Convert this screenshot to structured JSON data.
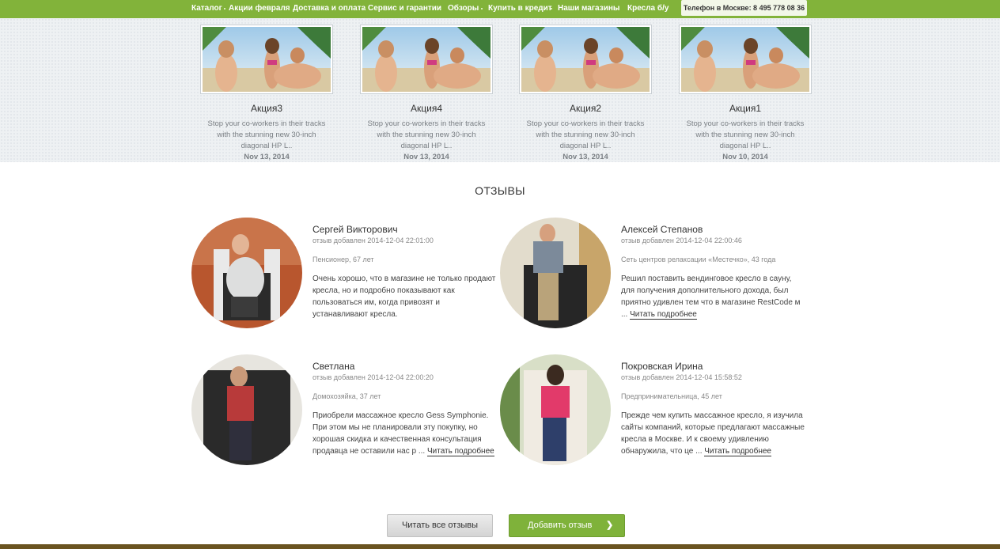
{
  "nav": {
    "items": [
      "Каталог",
      "Акции февраля",
      "Доставка и оплата",
      "Сервис и гарантии",
      "Обзоры",
      "Купить в кредит",
      "Наши магазины",
      "Кресла б/у"
    ],
    "phone": "Телефон в Москве: 8 495 778 08 36"
  },
  "promos": [
    {
      "title": "Акция3",
      "desc": "Stop your co-workers in their tracks with the stunning new 30-inch diagonal HP L..",
      "date": "Nov 13, 2014"
    },
    {
      "title": "Акция4",
      "desc": "Stop your co-workers in their tracks with the stunning new 30-inch diagonal HP L..",
      "date": "Nov 13, 2014"
    },
    {
      "title": "Акция2",
      "desc": "Stop your co-workers in their tracks with the stunning new 30-inch diagonal HP L..",
      "date": "Nov 13, 2014"
    },
    {
      "title": "Акция1",
      "desc": "Stop your co-workers in their tracks with the stunning new 30-inch diagonal HP L..",
      "date": "Nov 10, 2014"
    }
  ],
  "reviews_title": "ОТЗЫВЫ",
  "reviews": [
    {
      "name": "Сергей Викторович",
      "added": "отзыв добавлен 2014-12-04 22:01:00",
      "role": "Пенсионер, 67 лет",
      "text": "Очень хорошо, что в магазине не только продают кресла, но и подробно показывают как пользоваться им, когда привозят и устанавливают кресла.",
      "more": ""
    },
    {
      "name": "Алексей Степанов",
      "added": "отзыв добавлен 2014-12-04 22:00:46",
      "role": "Сеть центров релаксации «Местечко», 43 года",
      "text": "Решил поставить вендинговое кресло в сауну, для получения дополнительного дохода, был приятно удивлен тем что в магазине RestCode м ... ",
      "more": "Читать подробнее"
    },
    {
      "name": "Светлана",
      "added": "отзыв добавлен 2014-12-04 22:00:20",
      "role": "Домохозяйка, 37 лет",
      "text": "Приобрели массажное кресло Gess Symphonie. При этом мы не планировали эту покупку, но хорошая скидка и качественная консультация продавца не оставили нас р ... ",
      "more": "Читать подробнее"
    },
    {
      "name": "Покровская Ирина",
      "added": "отзыв добавлен 2014-12-04 15:58:52",
      "role": "Предпринимательница, 45 лет",
      "text": "Прежде чем купить массажное кресло, я изучила сайты компаний, которые предлагают массажные кресла в Москве. И к своему удивлению обнаружила, что це ... ",
      "more": "Читать подробнее"
    }
  ],
  "buttons": {
    "read_all": "Читать все отзывы",
    "add": "Добавить отзыв",
    "add_chevron": "❯"
  }
}
